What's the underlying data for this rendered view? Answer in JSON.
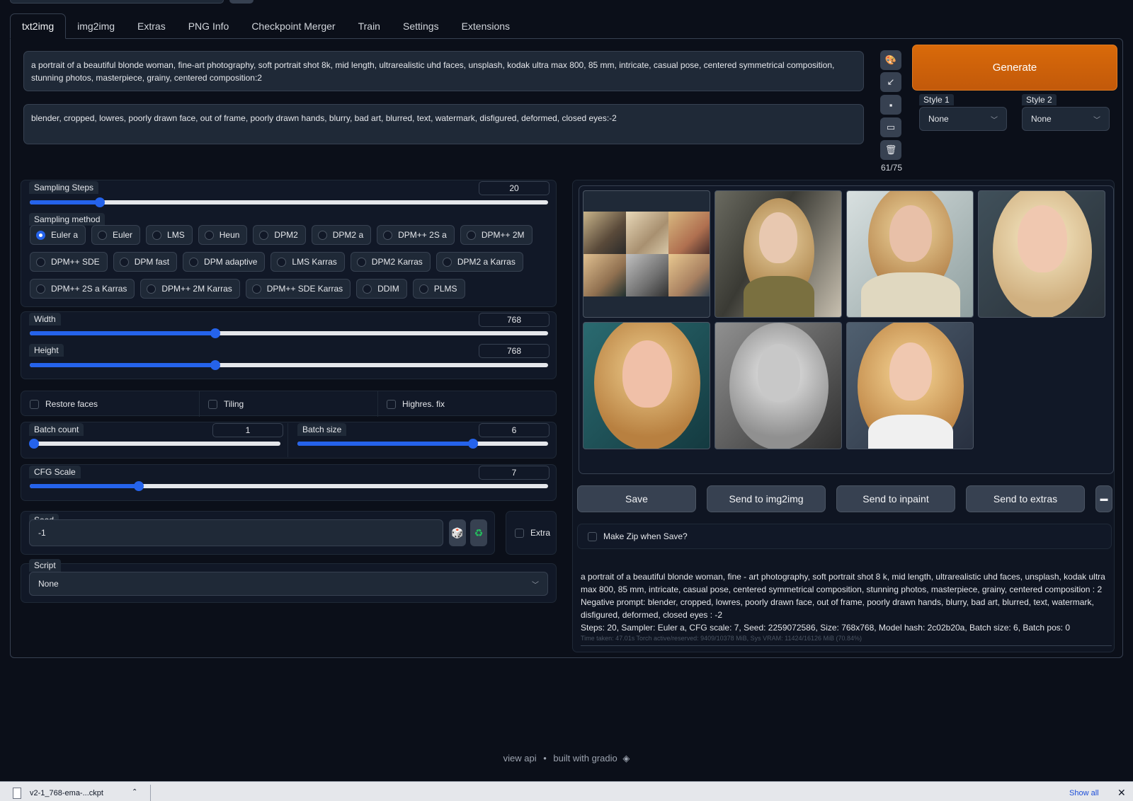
{
  "tabs": [
    "txt2img",
    "img2img",
    "Extras",
    "PNG Info",
    "Checkpoint Merger",
    "Train",
    "Settings",
    "Extensions"
  ],
  "prompt": "a portrait of a beautiful blonde woman, fine-art photography, soft portrait shot 8k, mid length, ultrarealistic uhd faces, unsplash, kodak ultra max 800, 85 mm, intricate, casual pose, centered symmetrical composition, stunning photos, masterpiece, grainy, centered composition:2",
  "negative_prompt": "blender, cropped, lowres, poorly drawn face, out of frame, poorly drawn hands, blurry, bad art, blurred, text, watermark, disfigured, deformed, closed eyes:-2",
  "token_count": "61/75",
  "generate_label": "Generate",
  "style1": {
    "label": "Style 1",
    "value": "None"
  },
  "style2": {
    "label": "Style 2",
    "value": "None"
  },
  "sampling_steps": {
    "label": "Sampling Steps",
    "value": "20",
    "fraction": 0.135
  },
  "sampling_method": {
    "label": "Sampling method",
    "selected": "Euler a",
    "rows": [
      [
        "Euler a",
        "Euler",
        "LMS",
        "Heun",
        "DPM2",
        "DPM2 a",
        "DPM++ 2S a",
        "DPM++ 2M"
      ],
      [
        "DPM++ SDE",
        "DPM fast",
        "DPM adaptive",
        "LMS Karras",
        "DPM2 Karras",
        "DPM2 a Karras"
      ],
      [
        "DPM++ 2S a Karras",
        "DPM++ 2M Karras",
        "DPM++ SDE Karras",
        "DDIM",
        "PLMS"
      ]
    ]
  },
  "width": {
    "label": "Width",
    "value": "768",
    "fraction": 0.358
  },
  "height": {
    "label": "Height",
    "value": "768",
    "fraction": 0.358
  },
  "checkboxes": {
    "restore_faces": "Restore faces",
    "tiling": "Tiling",
    "highres_fix": "Highres. fix"
  },
  "batch_count": {
    "label": "Batch count",
    "value": "1",
    "fraction": 0.0
  },
  "batch_size": {
    "label": "Batch size",
    "value": "6",
    "fraction": 0.7
  },
  "cfg_scale": {
    "label": "CFG Scale",
    "value": "7",
    "fraction": 0.21
  },
  "seed": {
    "label": "Seed",
    "value": "-1",
    "extra_label": "Extra"
  },
  "script": {
    "label": "Script",
    "value": "None"
  },
  "actions": {
    "save": "Save",
    "send_img2img": "Send to img2img",
    "send_inpaint": "Send to inpaint",
    "send_extras": "Send to extras"
  },
  "make_zip": "Make Zip when Save?",
  "info": {
    "line1": "a portrait of a beautiful blonde woman, fine - art photography, soft portrait shot 8 k, mid length, ultrarealistic uhd faces, unsplash, kodak ultra max 800, 85 mm, intricate, casual pose, centered symmetrical composition, stunning photos, masterpiece, grainy, centered composition : 2",
    "line2": "Negative prompt: blender, cropped, lowres, poorly drawn face, out of frame, poorly drawn hands, blurry, bad art, blurred, text, watermark, disfigured, deformed, closed eyes : -2",
    "line3": "Steps: 20, Sampler: Euler a, CFG scale: 7, Seed: 2259072586, Size: 768x768, Model hash: 2c02b20a, Batch size: 6, Batch pos: 0",
    "timing": "Time taken: 47.01s  Torch active/reserved: 9409/10378 MiB, Sys VRAM: 11424/16126 MiB (70.84%)"
  },
  "footer": {
    "view_api": "view api",
    "sep": "•",
    "built_with": "built with gradio"
  },
  "download_bar": {
    "file": "v2-1_768-ema-...ckpt",
    "show_all": "Show all"
  }
}
